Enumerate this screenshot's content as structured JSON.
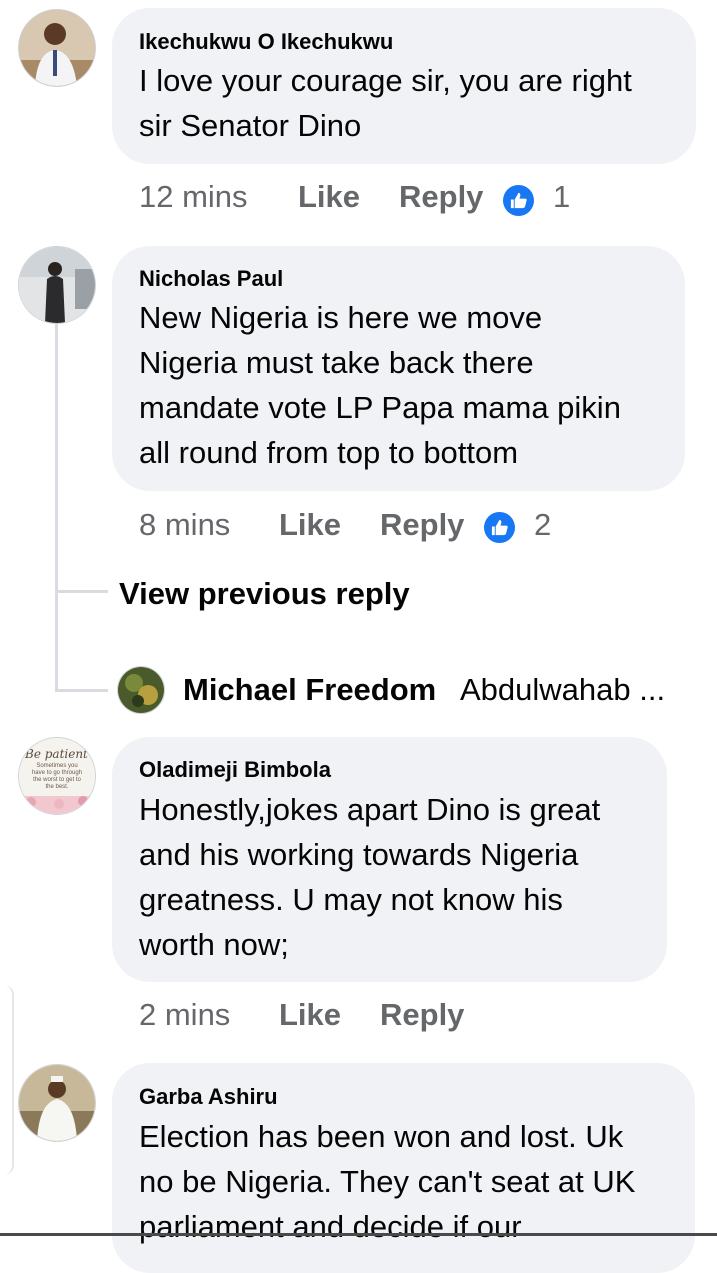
{
  "comments": [
    {
      "author": "Ikechukwu O Ikechukwu",
      "text": "I love your courage sir, you are right\nsir Senator Dino",
      "time": "12 mins",
      "like_label": "Like",
      "reply_label": "Reply",
      "reactions": "1"
    },
    {
      "author": "Nicholas Paul",
      "text": "New Nigeria is here we move\nNigeria must take back there\nmandate vote LP Papa mama pikin\nall round from top to bottom",
      "time": "8 mins",
      "like_label": "Like",
      "reply_label": "Reply",
      "reactions": "2"
    },
    {
      "author": "Oladimeji Bimbola",
      "text": "Honestly,jokes apart Dino is great\nand his working towards Nigeria\ngreatness. U may not know his\nworth now;",
      "time": "2 mins",
      "like_label": "Like",
      "reply_label": "Reply",
      "avatar_text": {
        "title": "Be patient",
        "body": "Sometimes you have to go through the worst to get to the best."
      }
    },
    {
      "author": "Garba Ashiru",
      "text": "Election has been won and lost. Uk\nno be Nigeria. They can't seat at UK\nparliament and decide if our"
    }
  ],
  "replies": {
    "view_previous": "View previous reply",
    "preview_author": "Michael Freedom",
    "preview_text": "Abdulwahab ..."
  },
  "colors": {
    "bubble": "#f0f2f5",
    "like_blue": "#1877f2",
    "meta_gray": "#65676b"
  }
}
